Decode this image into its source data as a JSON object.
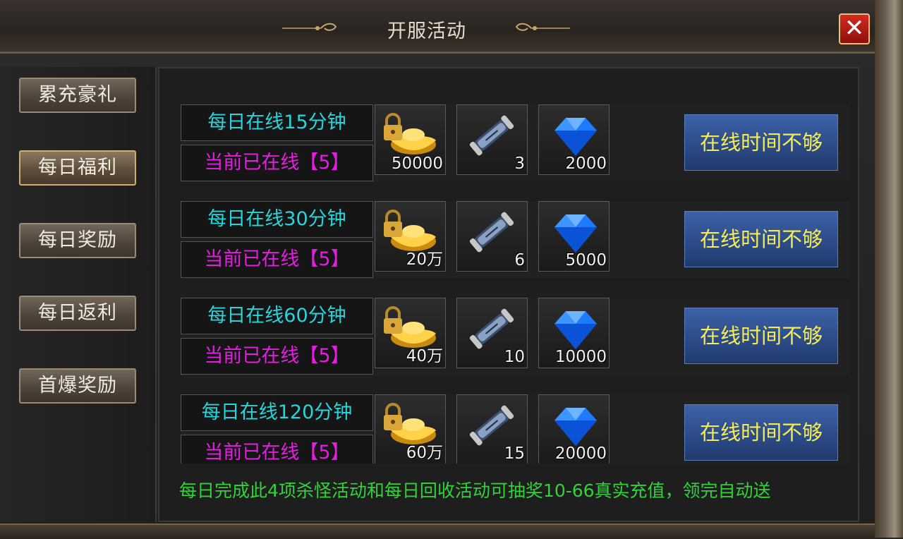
{
  "window": {
    "title": "开服活动",
    "close_label": "✕"
  },
  "sidebar": {
    "tabs": [
      {
        "label": "累充豪礼",
        "active": false
      },
      {
        "label": "每日福利",
        "active": true
      },
      {
        "label": "每日奖励",
        "active": false
      },
      {
        "label": "每日返利",
        "active": false
      },
      {
        "label": "首爆奖励",
        "active": false
      }
    ]
  },
  "rows": [
    {
      "requirement": "每日在线15分钟",
      "current": "当前已在线【5】",
      "rewards": [
        {
          "icon": "gold-ingot-lock-icon",
          "qty": "50000"
        },
        {
          "icon": "scroll-icon",
          "qty": "3"
        },
        {
          "icon": "blue-gem-icon",
          "qty": "2000"
        }
      ],
      "button": "在线时间不够"
    },
    {
      "requirement": "每日在线30分钟",
      "current": "当前已在线【5】",
      "rewards": [
        {
          "icon": "gold-ingot-lock-icon",
          "qty": "20万"
        },
        {
          "icon": "scroll-icon",
          "qty": "6"
        },
        {
          "icon": "blue-gem-icon",
          "qty": "5000"
        }
      ],
      "button": "在线时间不够"
    },
    {
      "requirement": "每日在线60分钟",
      "current": "当前已在线【5】",
      "rewards": [
        {
          "icon": "gold-ingot-lock-icon",
          "qty": "40万"
        },
        {
          "icon": "scroll-icon",
          "qty": "10"
        },
        {
          "icon": "blue-gem-icon",
          "qty": "10000"
        }
      ],
      "button": "在线时间不够"
    },
    {
      "requirement": "每日在线120分钟",
      "current": "当前已在线【5】",
      "rewards": [
        {
          "icon": "gold-ingot-lock-icon",
          "qty": "60万"
        },
        {
          "icon": "scroll-icon",
          "qty": "15"
        },
        {
          "icon": "blue-gem-icon",
          "qty": "20000"
        }
      ],
      "button": "在线时间不够"
    }
  ],
  "footer": {
    "notice": "每日完成此4项杀怪活动和每日回收活动可抽奖10-66真实充值，领完自动送"
  },
  "colors": {
    "requirement": "#27d6dc",
    "current": "#e41ee1",
    "button_text": "#f5ec55",
    "notice": "#32d33a"
  }
}
